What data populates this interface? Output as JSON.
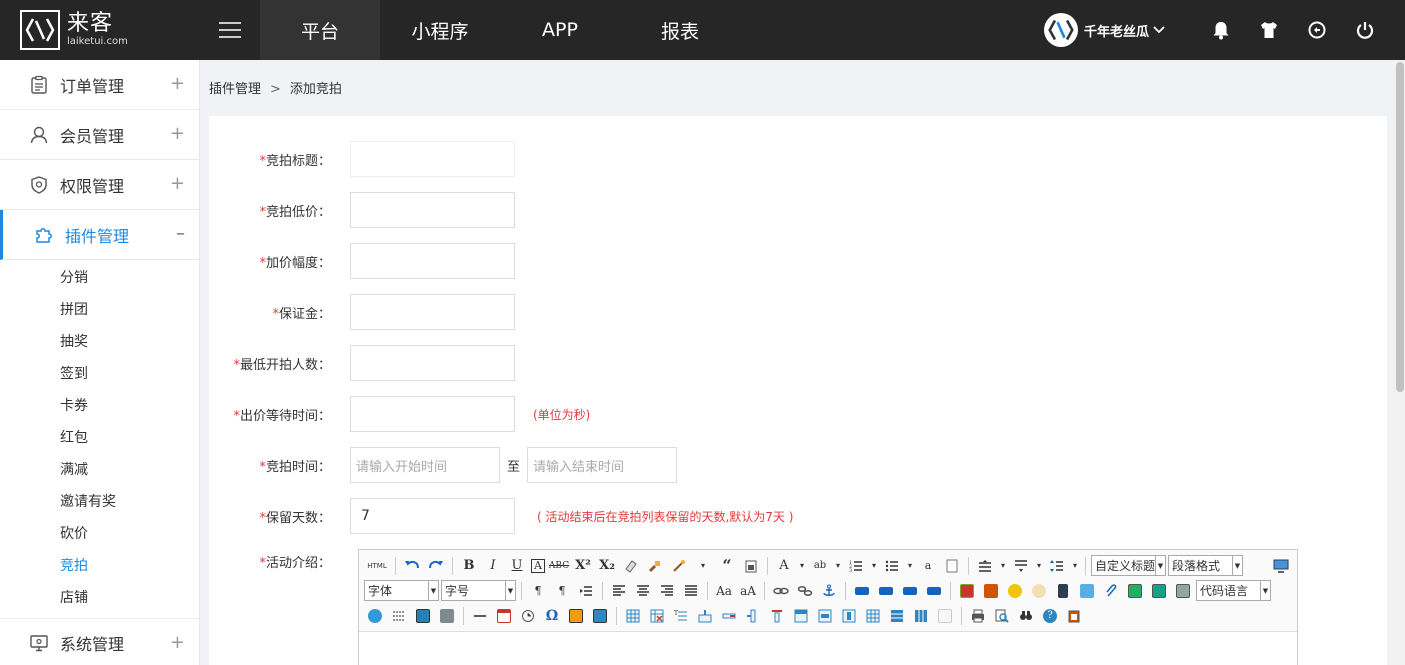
{
  "brand": {
    "name_cn": "来客",
    "name_en": "laiketui.com"
  },
  "topnav": [
    {
      "label": "平台",
      "active": true
    },
    {
      "label": "小程序",
      "active": false
    },
    {
      "label": "APP",
      "active": false
    },
    {
      "label": "报表",
      "active": false
    }
  ],
  "user": {
    "name": "千年老丝瓜"
  },
  "sidebar": {
    "items": [
      {
        "label": "订单管理",
        "icon": "clipboard-icon",
        "toggle": "+"
      },
      {
        "label": "会员管理",
        "icon": "user-icon",
        "toggle": "+"
      },
      {
        "label": "权限管理",
        "icon": "shield-icon",
        "toggle": "+"
      },
      {
        "label": "插件管理",
        "icon": "puzzle-icon",
        "toggle": "–"
      }
    ],
    "sub_items": [
      "分销",
      "拼团",
      "抽奖",
      "签到",
      "卡券",
      "红包",
      "满减",
      "邀请有奖",
      "砍价",
      "竞拍",
      "店铺"
    ],
    "active_sub": "竞拍",
    "bottom_item": {
      "label": "系统管理",
      "icon": "monitor-icon",
      "toggle": "+"
    }
  },
  "breadcrumb": {
    "parent": "插件管理",
    "separator": ">",
    "current": "添加竞拍"
  },
  "form": {
    "title_label": "竞拍标题：",
    "low_price_label": "竞拍低价：",
    "increment_label": "加价幅度：",
    "deposit_label": "保证金：",
    "min_people_label": "最低开拍人数：",
    "wait_time_label": "出价等待时间：",
    "wait_time_hint": "(单位为秒)",
    "time_label": "竞拍时间：",
    "start_placeholder": "请输入开始时间",
    "to_text": "至",
    "end_placeholder": "请输入结束时间",
    "keep_days_label": "保留天数：",
    "keep_days_value": "7",
    "keep_days_hint": "( 活动结束后在竞拍列表保留的天数,默认为7天 )",
    "intro_label": "活动介绍："
  },
  "editor": {
    "html_btn": "HTML",
    "custom_title": "自定义标题",
    "paragraph": "段落格式",
    "font": "字体",
    "font_size": "字号",
    "code_lang": "代码语言"
  },
  "colors": {
    "accent": "#1a8ae4",
    "required": "#e4393c",
    "topbar": "#262626"
  }
}
